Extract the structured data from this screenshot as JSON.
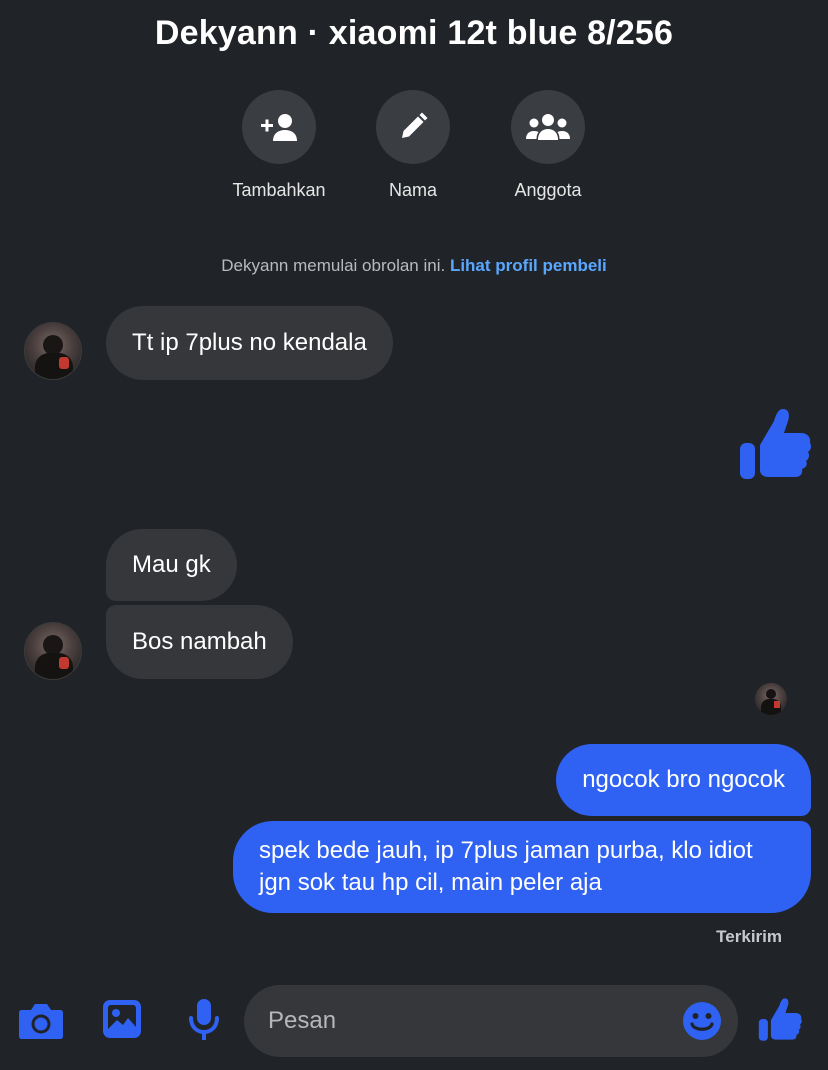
{
  "header": {
    "title": "Dekyann · xiaomi 12t blue 8/256",
    "actions": [
      {
        "label": "Tambahkan",
        "icon": "add-person-icon"
      },
      {
        "label": "Nama",
        "icon": "pencil-icon"
      },
      {
        "label": "Anggota",
        "icon": "group-icon"
      }
    ]
  },
  "system_note": {
    "text": "Dekyann memulai obrolan ini. ",
    "link": "Lihat profil pembeli"
  },
  "messages": [
    {
      "from": "them",
      "text": "Tt ip 7plus no kendala"
    },
    {
      "from": "me",
      "type": "like",
      "icon": "thumbs-up-icon"
    },
    {
      "from": "them",
      "text": "Mau gk"
    },
    {
      "from": "them",
      "text": "Bos nambah"
    },
    {
      "from": "me",
      "text": "ngocok bro ngocok"
    },
    {
      "from": "me",
      "text": "spek bede jauh, ip 7plus jaman purba, klo idiot jgn sok tau hp cil, main peler aja"
    }
  ],
  "status": "Terkirim",
  "composer": {
    "placeholder": "Pesan",
    "icons": [
      "camera-icon",
      "image-icon",
      "microphone-icon",
      "emoji-icon",
      "thumbs-up-icon"
    ]
  },
  "colors": {
    "background": "#202327",
    "incoming_bubble": "#35373b",
    "outgoing_bubble": "#2f62f2",
    "accent": "#2f62f2",
    "link": "#5aa7ff"
  }
}
